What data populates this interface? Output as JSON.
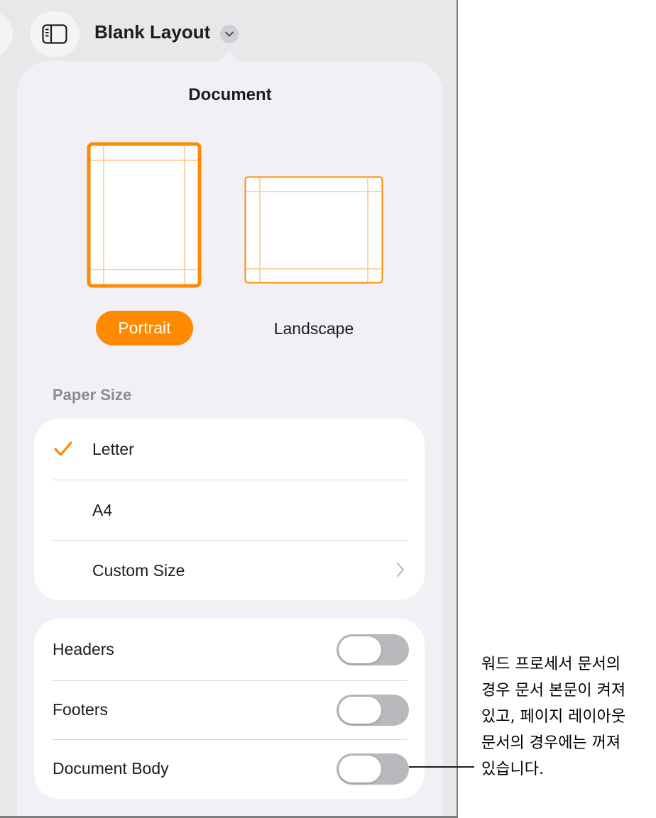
{
  "toolbar": {
    "title": "Blank Layout",
    "sidebar_icon": "sidebar-icon",
    "title_menu_icon": "chevron-down-icon"
  },
  "popover": {
    "title": "Document",
    "orientation": {
      "options": [
        "Portrait",
        "Landscape"
      ],
      "selected": "Portrait"
    },
    "paper_size": {
      "header": "Paper Size",
      "items": [
        {
          "label": "Letter",
          "selected": true
        },
        {
          "label": "A4",
          "selected": false
        },
        {
          "label": "Custom Size",
          "selected": false,
          "icon": "chevron-right-icon"
        }
      ]
    },
    "toggles": [
      {
        "label": "Headers",
        "on": false
      },
      {
        "label": "Footers",
        "on": false
      },
      {
        "label": "Document Body",
        "on": false
      }
    ]
  },
  "callout": {
    "lines": [
      "워드 프로세서 문서의",
      "경우 문서 본문이 켜져",
      "있고, 페이지 레이아웃",
      "문서의 경우에는 꺼져",
      "있습니다."
    ]
  },
  "colors": {
    "accent": "#ff8a00",
    "background": "#e8e7ea",
    "popover": "#f1f1f5",
    "group": "#ffffff",
    "toggle_off": "#b9b9bd",
    "secondary_text": "#8c8c90"
  }
}
